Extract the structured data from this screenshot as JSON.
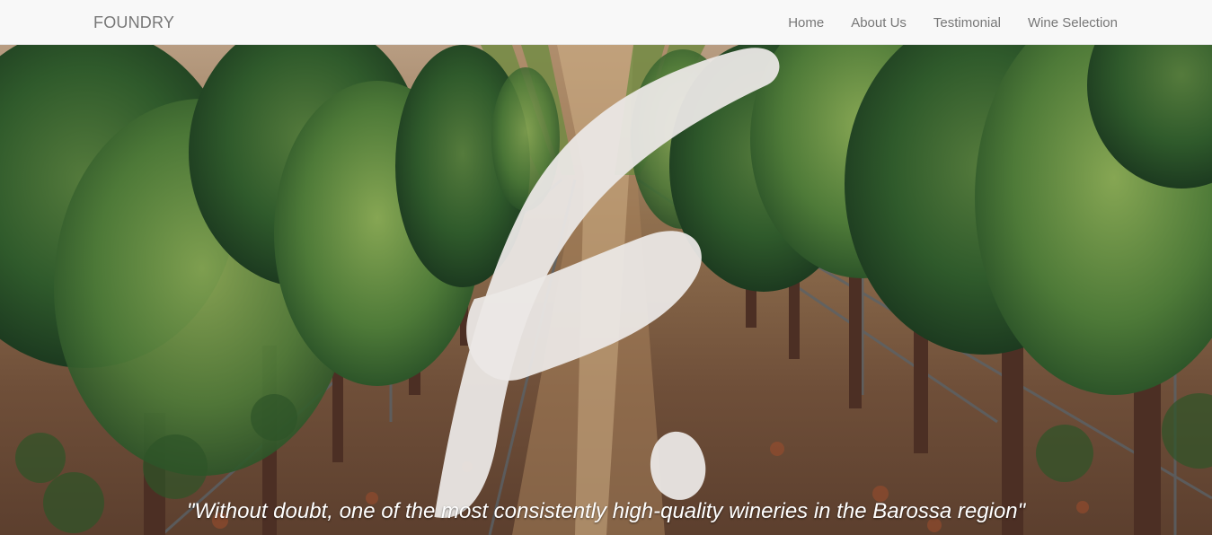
{
  "brand": {
    "name": "FOUNDRY"
  },
  "navigation": {
    "items": [
      "Home",
      "About Us",
      "Testimonial",
      "Wine Selection"
    ]
  },
  "hero": {
    "background": "vineyard rows with grapevines",
    "logo_icon": "brush-stroke-f-icon",
    "quote": "\"Without doubt, one of the most consistently high-quality wineries in the Barossa region\""
  },
  "colors": {
    "navbar_background": "#f8f8f8",
    "nav_text": "#777777",
    "quote_text": "#ffffff",
    "logo_mark": "#ebe8e6"
  }
}
